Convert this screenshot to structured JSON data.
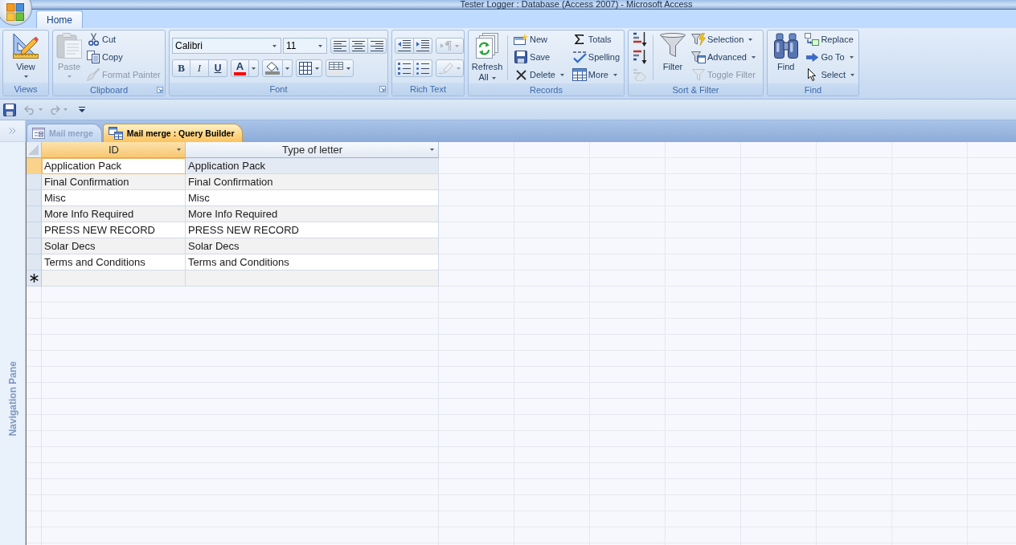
{
  "window": {
    "title": "Tester Logger : Database (Access 2007) - Microsoft Access"
  },
  "ribbon": {
    "tabs": [
      {
        "label": "Home",
        "selected": true
      }
    ],
    "groups": [
      {
        "label": "Views",
        "buttons": [
          {
            "label": "View"
          }
        ]
      },
      {
        "label": "Clipboard",
        "buttons": [
          {
            "label": "Paste",
            "disabled": true
          },
          {
            "label": "Cut",
            "disabled": false
          },
          {
            "label": "Copy",
            "disabled": false
          },
          {
            "label": "Format Painter",
            "disabled": true
          }
        ]
      },
      {
        "label": "Font",
        "font_name": "Calibri",
        "font_size": "11",
        "buttons": [
          {
            "label": "B"
          },
          {
            "label": "I"
          },
          {
            "label": "U"
          },
          {
            "label": "A"
          }
        ]
      },
      {
        "label": "Rich Text",
        "buttons": [
          {
            "disabled": false
          },
          {
            "disabled": false
          },
          {
            "disabled": true
          },
          {
            "disabled": false
          },
          {
            "disabled": false
          },
          {
            "disabled": true
          }
        ]
      },
      {
        "label": "Records",
        "buttons": [
          {
            "label": "Refresh All"
          },
          {
            "label": "New"
          },
          {
            "label": "Save"
          },
          {
            "label": "Delete"
          },
          {
            "label": "Totals"
          },
          {
            "label": "Spelling"
          },
          {
            "label": "More"
          }
        ]
      },
      {
        "label": "Sort & Filter",
        "buttons": [
          {
            "disabled": false
          },
          {
            "disabled": false
          },
          {
            "disabled": true
          },
          {
            "label": "Filter",
            "disabled": false
          },
          {
            "label": "Selection",
            "disabled": false
          },
          {
            "label": "Advanced",
            "disabled": false
          },
          {
            "label": "Toggle Filter",
            "disabled": true
          }
        ]
      },
      {
        "label": "Find",
        "buttons": [
          {
            "label": "Find"
          },
          {
            "label": "Replace"
          },
          {
            "label": "Go To"
          },
          {
            "label": "Select"
          }
        ]
      }
    ]
  },
  "quick_access": [
    {
      "disabled": false
    },
    {
      "disabled": true
    },
    {
      "disabled": true
    }
  ],
  "navigation_pane": {
    "label": "Navigation Pane"
  },
  "document_tabs": [
    {
      "label": "Mail merge",
      "selected": false
    },
    {
      "label": "Mail merge : Query Builder",
      "selected": true
    }
  ],
  "datasheet": {
    "columns": [
      {
        "label": "ID",
        "selected": true
      },
      {
        "label": "Type of letter",
        "selected": false
      }
    ],
    "rows": [
      {
        "cells": [
          "Application Pack",
          "Application Pack"
        ],
        "selected": true
      },
      {
        "cells": [
          "Final Confirmation",
          "Final Confirmation"
        ],
        "selected": false
      },
      {
        "cells": [
          "Misc",
          "Misc"
        ],
        "selected": false
      },
      {
        "cells": [
          "More Info Required",
          "More Info Required"
        ],
        "selected": false
      },
      {
        "cells": [
          "PRESS NEW RECORD",
          "PRESS NEW RECORD"
        ],
        "selected": false
      },
      {
        "cells": [
          "Solar Decs",
          "Solar Decs"
        ],
        "selected": false
      },
      {
        "cells": [
          "Terms and Conditions",
          "Terms and Conditions"
        ],
        "selected": false
      }
    ]
  }
}
